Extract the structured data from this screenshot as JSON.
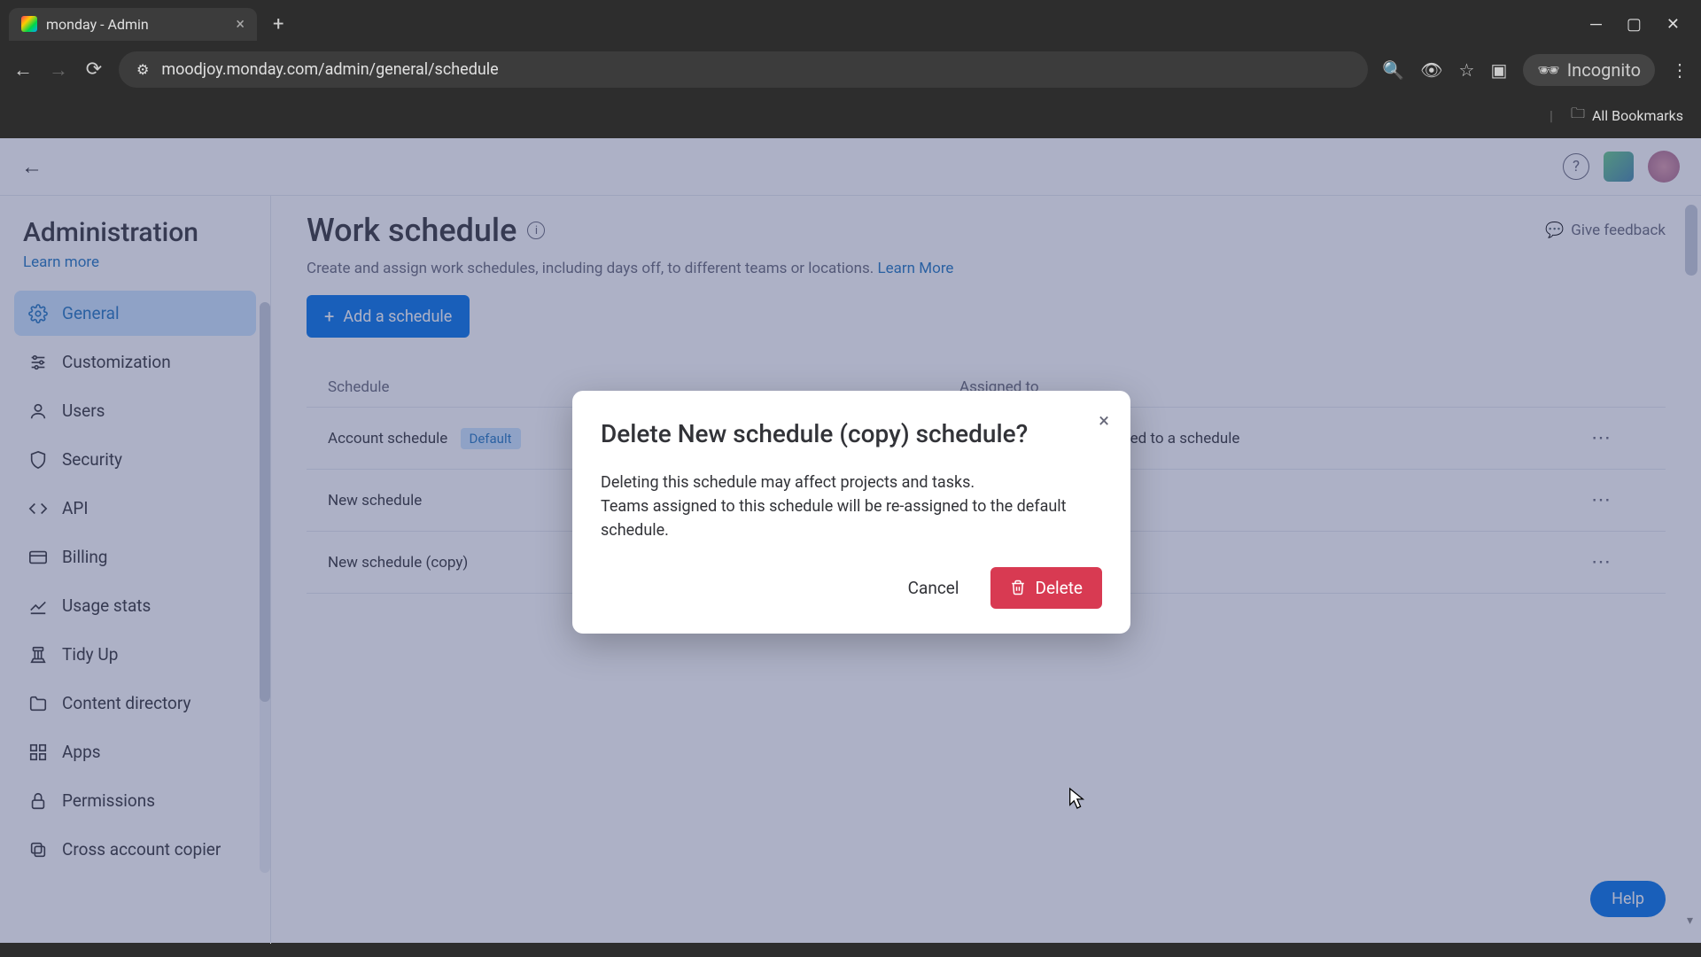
{
  "browser": {
    "tab_title": "monday - Admin",
    "url": "moodjoy.monday.com/admin/general/schedule",
    "incognito_label": "Incognito",
    "all_bookmarks": "All Bookmarks"
  },
  "app_header": {},
  "sidebar": {
    "title": "Administration",
    "learn_more": "Learn more",
    "items": [
      {
        "label": "General",
        "icon": "gear"
      },
      {
        "label": "Customization",
        "icon": "sliders"
      },
      {
        "label": "Users",
        "icon": "user"
      },
      {
        "label": "Security",
        "icon": "shield"
      },
      {
        "label": "API",
        "icon": "code"
      },
      {
        "label": "Billing",
        "icon": "card"
      },
      {
        "label": "Usage stats",
        "icon": "chart"
      },
      {
        "label": "Tidy Up",
        "icon": "broom"
      },
      {
        "label": "Content directory",
        "icon": "folder"
      },
      {
        "label": "Apps",
        "icon": "grid"
      },
      {
        "label": "Permissions",
        "icon": "lock"
      },
      {
        "label": "Cross account copier",
        "icon": "copy"
      }
    ]
  },
  "content": {
    "title": "Work schedule",
    "subtitle": "Create and assign work schedules, including days off, to different teams or locations.",
    "learn_more": "Learn More",
    "feedback": "Give feedback",
    "add_button": "Add a schedule",
    "table": {
      "col_schedule": "Schedule",
      "col_assigned": "Assigned to",
      "rows": [
        {
          "name": "Account schedule",
          "badge": "Default",
          "assigned": "Anyone who is not assigned to a schedule"
        },
        {
          "name": "New schedule",
          "badge": "",
          "assigned": ""
        },
        {
          "name": "New schedule (copy)",
          "badge": "",
          "assigned": ""
        }
      ]
    },
    "help": "Help"
  },
  "modal": {
    "title": "Delete New schedule (copy) schedule?",
    "body_line1": "Deleting this schedule may affect projects and tasks.",
    "body_line2": "Teams assigned to this schedule will be re-assigned to the default schedule.",
    "cancel": "Cancel",
    "delete": "Delete"
  }
}
